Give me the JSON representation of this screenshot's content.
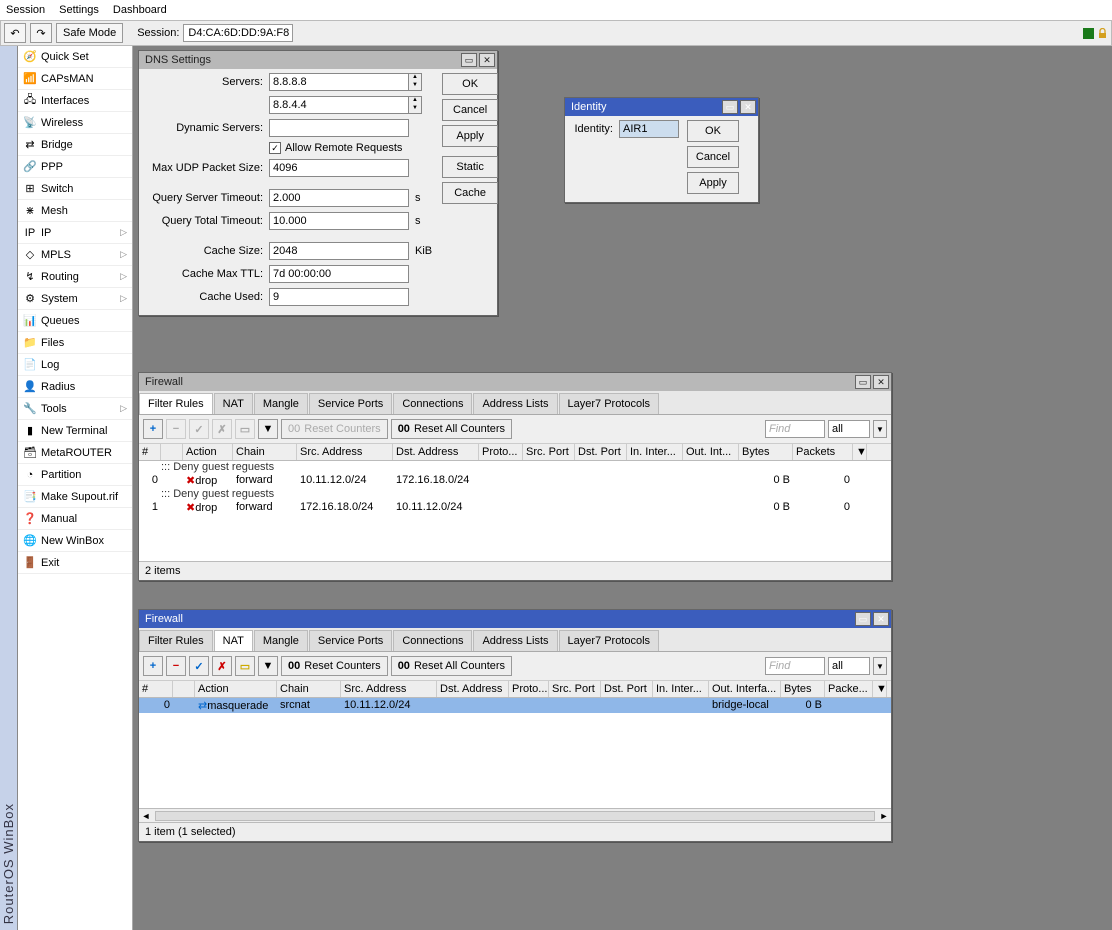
{
  "menu": {
    "session": "Session",
    "settings": "Settings",
    "dashboard": "Dashboard"
  },
  "toolbar": {
    "undo": "↶",
    "redo": "↷",
    "safemode": "Safe Mode",
    "session_label": "Session:",
    "session": "D4:CA:6D:DD:9A:F8"
  },
  "vstrip": "RouterOS WinBox",
  "sidebar": [
    {
      "icon": "🧭",
      "label": "Quick Set",
      "sub": false
    },
    {
      "icon": "📶",
      "label": "CAPsMAN",
      "sub": false
    },
    {
      "icon": "🖧",
      "label": "Interfaces",
      "sub": false
    },
    {
      "icon": "📡",
      "label": "Wireless",
      "sub": false
    },
    {
      "icon": "⇄",
      "label": "Bridge",
      "sub": false
    },
    {
      "icon": "🔗",
      "label": "PPP",
      "sub": false
    },
    {
      "icon": "⊞",
      "label": "Switch",
      "sub": false
    },
    {
      "icon": "⋇",
      "label": "Mesh",
      "sub": false
    },
    {
      "icon": "IP",
      "label": "IP",
      "sub": true
    },
    {
      "icon": "◇",
      "label": "MPLS",
      "sub": true
    },
    {
      "icon": "↯",
      "label": "Routing",
      "sub": true
    },
    {
      "icon": "⚙",
      "label": "System",
      "sub": true
    },
    {
      "icon": "📊",
      "label": "Queues",
      "sub": false
    },
    {
      "icon": "📁",
      "label": "Files",
      "sub": false
    },
    {
      "icon": "📄",
      "label": "Log",
      "sub": false
    },
    {
      "icon": "👤",
      "label": "Radius",
      "sub": false
    },
    {
      "icon": "🔧",
      "label": "Tools",
      "sub": true
    },
    {
      "icon": "▮",
      "label": "New Terminal",
      "sub": false
    },
    {
      "icon": "🗃",
      "label": "MetaROUTER",
      "sub": false
    },
    {
      "icon": "◔",
      "label": "Partition",
      "sub": false
    },
    {
      "icon": "📑",
      "label": "Make Supout.rif",
      "sub": false
    },
    {
      "icon": "❓",
      "label": "Manual",
      "sub": false
    },
    {
      "icon": "🌐",
      "label": "New WinBox",
      "sub": false
    },
    {
      "icon": "🚪",
      "label": "Exit",
      "sub": false
    }
  ],
  "dns": {
    "title": "DNS Settings",
    "servers_label": "Servers:",
    "server1": "8.8.8.8",
    "server2": "8.8.4.4",
    "dyn_label": "Dynamic Servers:",
    "dyn": "",
    "allow_remote_label": "Allow Remote Requests",
    "allow_remote": "✓",
    "max_udp_label": "Max UDP Packet Size:",
    "max_udp": "4096",
    "qst_label": "Query Server Timeout:",
    "qst": "2.000",
    "qst_unit": "s",
    "qtt_label": "Query Total Timeout:",
    "qtt": "10.000",
    "qtt_unit": "s",
    "cache_size_label": "Cache Size:",
    "cache_size": "2048",
    "cache_size_unit": "KiB",
    "cache_ttl_label": "Cache Max TTL:",
    "cache_ttl": "7d 00:00:00",
    "cache_used_label": "Cache Used:",
    "cache_used": "9",
    "btn_ok": "OK",
    "btn_cancel": "Cancel",
    "btn_apply": "Apply",
    "btn_static": "Static",
    "btn_cache": "Cache"
  },
  "identity": {
    "title": "Identity",
    "label": "Identity:",
    "value": "AIR1",
    "btn_ok": "OK",
    "btn_cancel": "Cancel",
    "btn_apply": "Apply"
  },
  "fw_tabs": [
    "Filter Rules",
    "NAT",
    "Mangle",
    "Service Ports",
    "Connections",
    "Address Lists",
    "Layer7 Protocols"
  ],
  "fw_toolbar": {
    "reset": "Reset Counters",
    "reset_all": "Reset All Counters",
    "find": "Find",
    "filter": "all",
    "counter_ico": "00"
  },
  "fw_cols": [
    "#",
    "",
    "Action",
    "Chain",
    "Src. Address",
    "Dst. Address",
    "Proto...",
    "Src. Port",
    "Dst. Port",
    "In. Inter...",
    "Out. Int...",
    "Bytes",
    "Packets"
  ],
  "fw1": {
    "title": "Firewall",
    "active_tab": 0,
    "rows": [
      {
        "comment": "::: Deny guest reguests"
      },
      {
        "num": "0",
        "action": "drop",
        "chain": "forward",
        "src": "10.11.12.0/24",
        "dst": "172.16.18.0/24",
        "bytes": "0 B",
        "packets": "0"
      },
      {
        "comment": "::: Deny guest reguests"
      },
      {
        "num": "1",
        "action": "drop",
        "chain": "forward",
        "src": "172.16.18.0/24",
        "dst": "10.11.12.0/24",
        "bytes": "0 B",
        "packets": "0"
      }
    ],
    "footer": "2 items"
  },
  "fw2_cols": [
    "#",
    "",
    "Action",
    "Chain",
    "Src. Address",
    "Dst. Address",
    "Proto...",
    "Src. Port",
    "Dst. Port",
    "In. Inter...",
    "Out. Interfa...",
    "Bytes",
    "Packe..."
  ],
  "fw2": {
    "title": "Firewall",
    "active_tab": 1,
    "rows": [
      {
        "num": "0",
        "action": "masquerade",
        "chain": "srcnat",
        "src": "10.11.12.0/24",
        "outif": "bridge-local",
        "bytes": "0 B"
      }
    ],
    "footer": "1 item (1 selected)"
  }
}
